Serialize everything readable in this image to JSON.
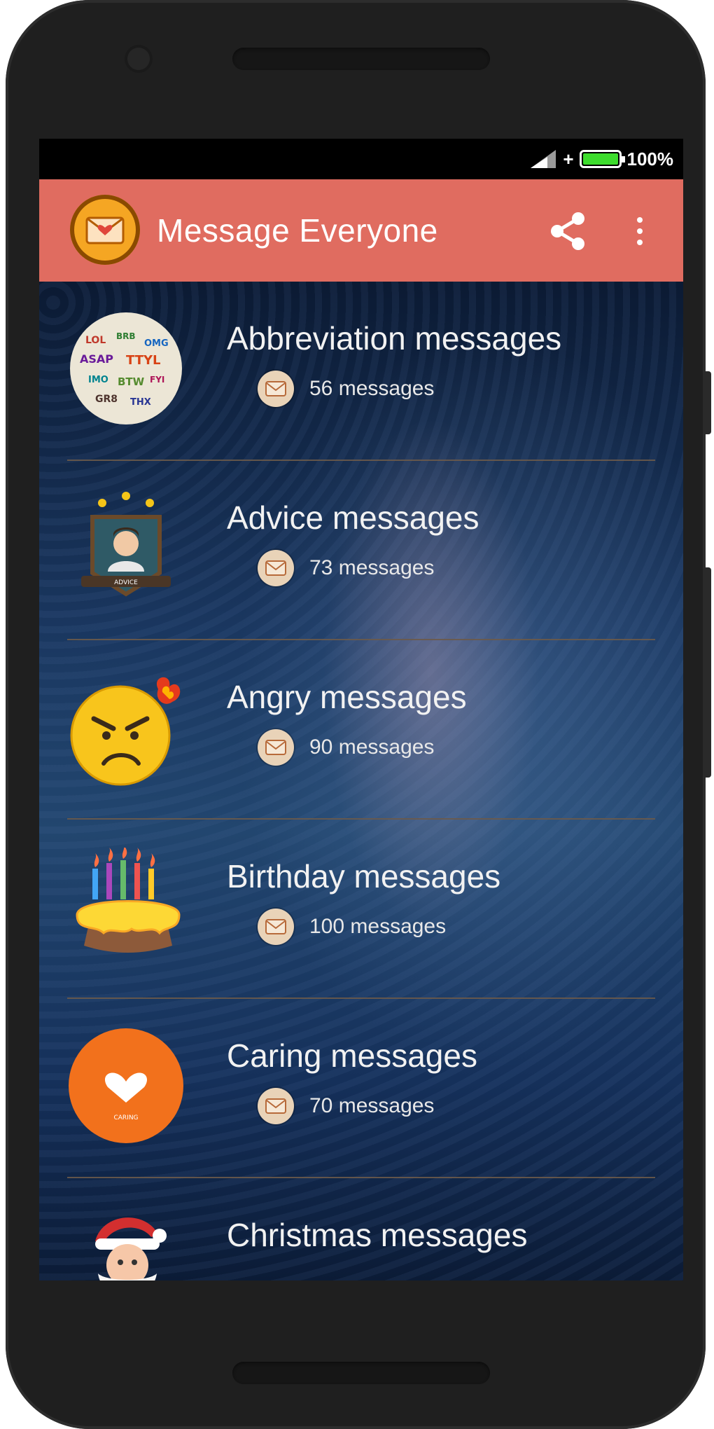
{
  "status_bar": {
    "battery_percent": "100%",
    "battery_level": 1.0,
    "signal_icon": "signal-icon",
    "battery_icon": "battery-icon"
  },
  "app_bar": {
    "title": "Message Everyone",
    "background_color": "#e06c60",
    "logo_icon": "envelope-heart-icon",
    "share_icon": "share-icon",
    "more_icon": "more-vert-icon"
  },
  "categories": [
    {
      "title": "Abbreviation messages",
      "count_label": "56 messages",
      "icon": "word-cloud-icon"
    },
    {
      "title": "Advice messages",
      "count_label": "73 messages",
      "icon": "advice-badge-icon"
    },
    {
      "title": "Angry messages",
      "count_label": "90 messages",
      "icon": "angry-face-icon"
    },
    {
      "title": "Birthday messages",
      "count_label": "100 messages",
      "icon": "birthday-cake-icon"
    },
    {
      "title": "Caring messages",
      "count_label": "70 messages",
      "icon": "heart-icon"
    },
    {
      "title": "Christmas messages",
      "count_label": "",
      "icon": "santa-icon"
    }
  ]
}
